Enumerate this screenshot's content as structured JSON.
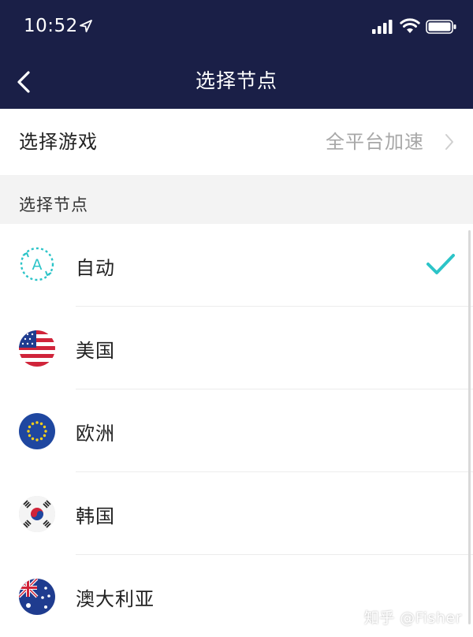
{
  "status_bar": {
    "time": "10:52",
    "icons": [
      "location-arrow-icon",
      "signal-icon",
      "wifi-icon",
      "battery-icon"
    ]
  },
  "nav": {
    "title": "选择节点",
    "back_icon": "chevron-left-icon"
  },
  "game_row": {
    "label": "选择游戏",
    "value": "全平台加速"
  },
  "section": {
    "title": "选择节点"
  },
  "nodes": [
    {
      "label": "自动",
      "icon": "auto-icon",
      "selected": true
    },
    {
      "label": "美国",
      "icon": "usa-flag-icon",
      "selected": false
    },
    {
      "label": "欧洲",
      "icon": "eu-flag-icon",
      "selected": false
    },
    {
      "label": "韩国",
      "icon": "korea-flag-icon",
      "selected": false
    },
    {
      "label": "澳大利亚",
      "icon": "australia-flag-icon",
      "selected": false
    }
  ],
  "watermark": "知乎 @Fisher",
  "colors": {
    "header_bg": "#1a1f47",
    "accent": "#2cc4c8",
    "section_bg": "#f3f3f3",
    "muted_text": "#a7a7a7"
  }
}
